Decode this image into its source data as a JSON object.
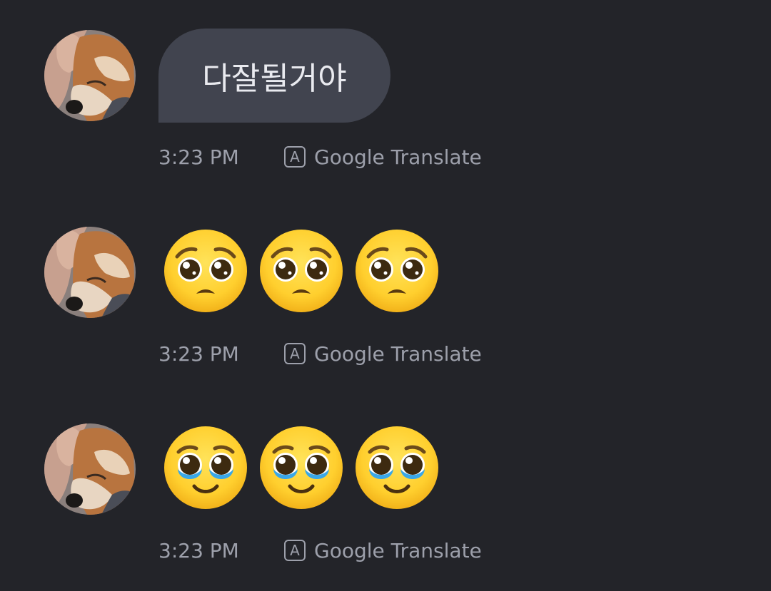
{
  "messages": [
    {
      "type": "text",
      "text": "다잘될거야",
      "time": "3:23 PM",
      "translate_label": "Google Translate"
    },
    {
      "type": "emoji",
      "emoji_name": "pleading-face",
      "count": 3,
      "time": "3:23 PM",
      "translate_label": "Google Translate"
    },
    {
      "type": "emoji",
      "emoji_name": "face-holding-back-tears",
      "count": 3,
      "time": "3:23 PM",
      "translate_label": "Google Translate"
    }
  ],
  "translate_icon_glyph": "A",
  "colors": {
    "background": "#232429",
    "bubble": "#41444f",
    "bubble_text": "#e9eaef",
    "meta_text": "#9da0ab"
  }
}
